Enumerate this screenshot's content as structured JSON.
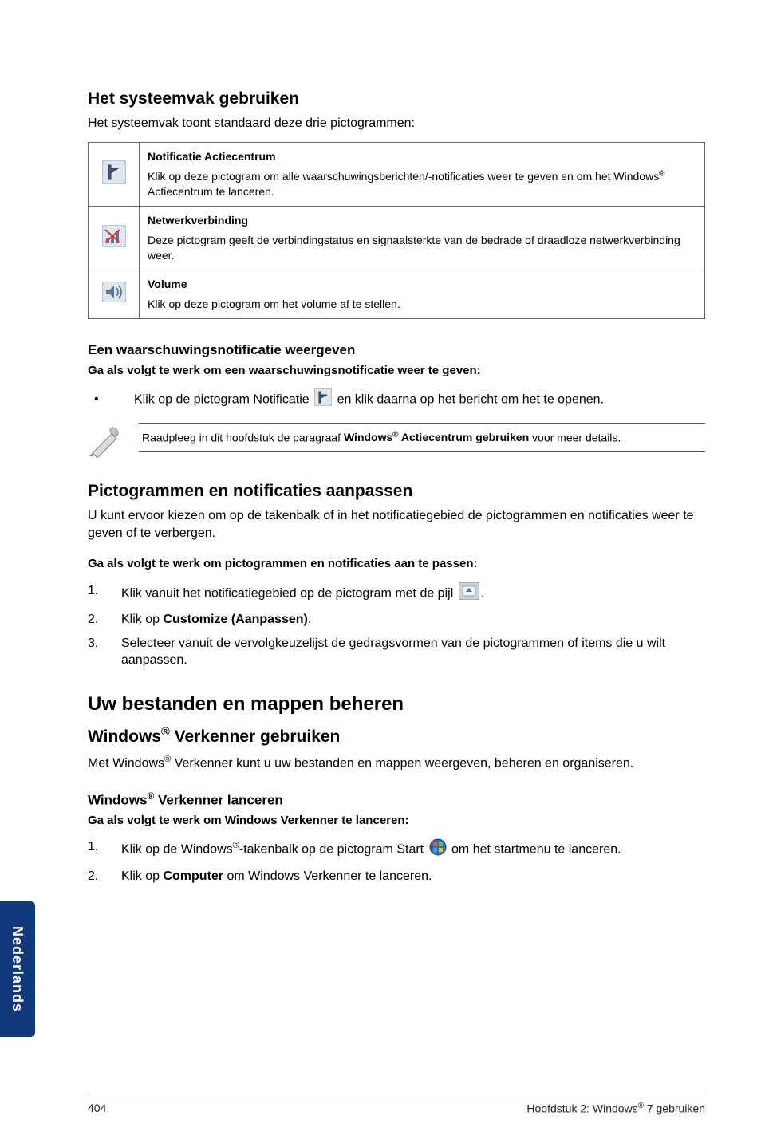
{
  "sidebar_label": "Nederlands",
  "s1": {
    "heading": "Het systeemvak gebruiken",
    "lead": "Het systeemvak toont standaard deze drie pictogrammen:",
    "rows": [
      {
        "title": "Notificatie Actiecentrum",
        "desc_a": "Klik op deze pictogram om alle waarschuwingsberichten/-notificaties weer te geven en om het Windows",
        "desc_b": " Actiecentrum te lanceren."
      },
      {
        "title": "Netwerkverbinding",
        "desc_a": "Deze pictogram geeft de verbindingstatus en signaalsterkte van de bedrade of draadloze netwerkverbinding weer.",
        "desc_b": ""
      },
      {
        "title": "Volume",
        "desc_a": "Klik op deze pictogram om het volume af te stellen.",
        "desc_b": ""
      }
    ]
  },
  "s2": {
    "heading": "Een waarschuwingsnotificatie weergeven",
    "bold": "Ga als volgt te werk om een waarschuwingsnotificatie weer te geven:",
    "bullet_a": "Klik op de pictogram Notificatie ",
    "bullet_b": " en klik daarna op het bericht om het te openen."
  },
  "note": {
    "pre": "Raadpleeg in dit hoofdstuk de paragraaf ",
    "bold_a": "Windows",
    "bold_b": " Actiecentrum gebruiken",
    "post": " voor meer details."
  },
  "s3": {
    "heading": "Pictogrammen en notificaties aanpassen",
    "lead": "U kunt ervoor kiezen om op de takenbalk of in het notificatiegebied de pictogrammen en notificaties weer te geven of te verbergen.",
    "bold": "Ga als volgt te werk om pictogrammen en notificaties aan te passen:",
    "steps": {
      "s1_a": "Klik vanuit het notificatiegebied op de pictogram met de pijl ",
      "s1_b": ".",
      "s2_a": "Klik op ",
      "s2_b": "Customize (Aanpassen)",
      "s2_c": ".",
      "s3": "Selecteer vanuit de vervolgkeuzelijst de gedragsvormen van de pictogrammen of items die u wilt aanpassen."
    }
  },
  "s4": {
    "bigheading": "Uw bestanden en mappen beheren",
    "heading_a": "Windows",
    "heading_b": " Verkenner gebruiken",
    "lead_a": "Met Windows",
    "lead_b": " Verkenner kunt u uw bestanden en mappen weergeven, beheren en organiseren."
  },
  "s5": {
    "heading_a": "Windows",
    "heading_b": " Verkenner lanceren",
    "bold": "Ga als volgt te werk om Windows Verkenner te lanceren:",
    "steps": {
      "s1_a": "Klik op de Windows",
      "s1_b": "-takenbalk op de pictogram Start ",
      "s1_c": " om het startmenu te lanceren.",
      "s2_a": "Klik op ",
      "s2_b": "Computer",
      "s2_c": " om Windows Verkenner te lanceren."
    }
  },
  "footer": {
    "page": "404",
    "right_a": "Hoofdstuk 2: Windows",
    "right_b": " 7 gebruiken"
  }
}
